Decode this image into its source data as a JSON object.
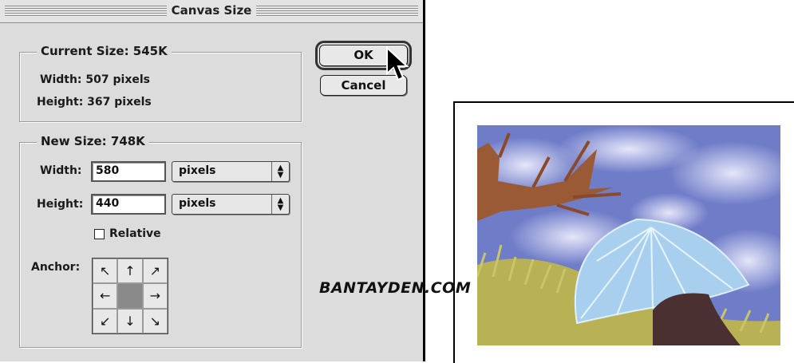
{
  "dialog": {
    "title": "Canvas Size",
    "current_size": {
      "legend": "Current Size: 545K",
      "width_label": "Width: 507 pixels",
      "height_label": "Height: 367 pixels"
    },
    "new_size": {
      "legend": "New Size: 748K",
      "width_label": "Width:",
      "width_value": "580",
      "width_unit": "pixels",
      "height_label": "Height:",
      "height_value": "440",
      "height_unit": "pixels",
      "relative_label": "Relative",
      "relative_checked": false,
      "anchor_label": "Anchor:",
      "anchor_arrows": [
        "↖",
        "↑",
        "↗",
        "←",
        "",
        "→",
        "↙",
        "↓",
        "↘"
      ]
    },
    "buttons": {
      "ok": "OK",
      "cancel": "Cancel"
    }
  },
  "watermark": "BANTAYDEN.COM",
  "colors": {
    "dialog_bg": "#dcdcdc",
    "sky": "#6f7cc8",
    "grass": "#b8b255",
    "umbrella": "#a8d0ee",
    "trunk": "#9a5a36"
  }
}
